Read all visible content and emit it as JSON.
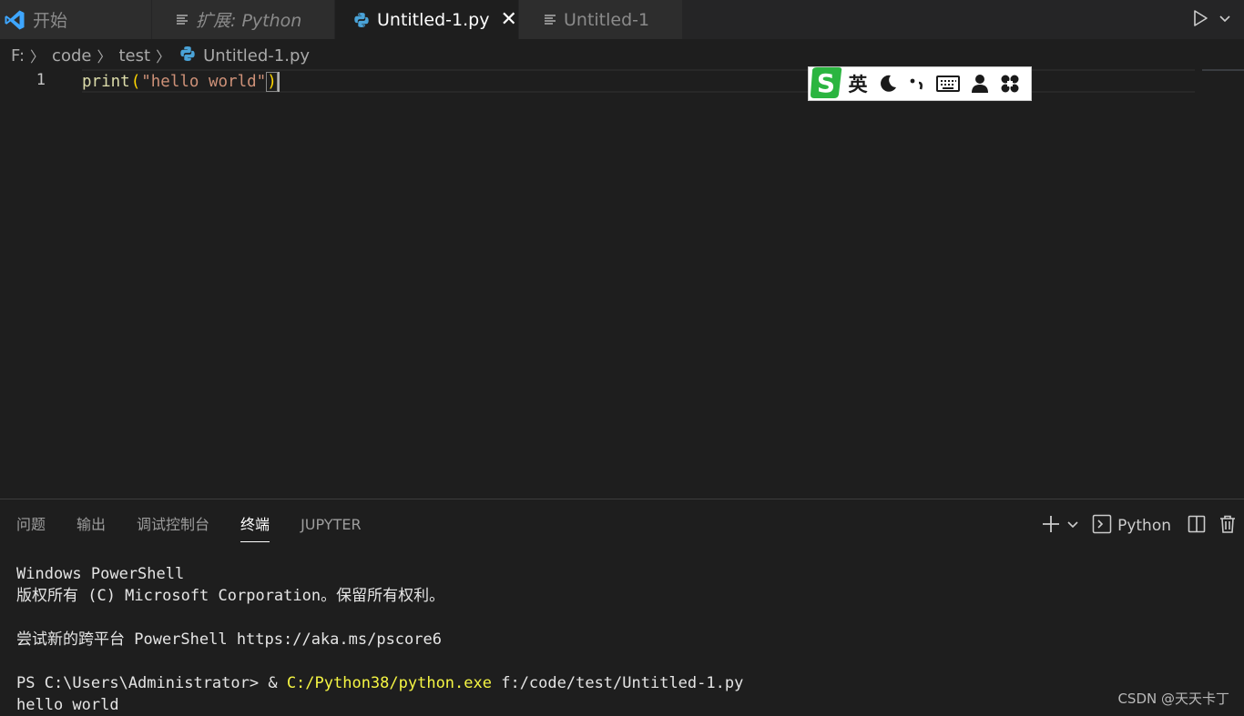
{
  "tabs": [
    {
      "label": "开始",
      "icon": "vscode-logo-icon"
    },
    {
      "label": "扩展: Python",
      "icon": "preview-lines-icon"
    },
    {
      "label": "Untitled-1.py",
      "icon": "python-icon",
      "active": true
    },
    {
      "label": "Untitled-1",
      "icon": "text-file-icon"
    }
  ],
  "breadcrumb": {
    "drive": "F:",
    "folder1": "code",
    "folder2": "test",
    "file": "Untitled-1.py"
  },
  "editor": {
    "line_number": "1",
    "code": {
      "fn": "print",
      "open_paren": "(",
      "string": "\"hello world\"",
      "close_paren": ")"
    }
  },
  "ime_toolbar": {
    "logo": "S",
    "language": "英",
    "icons": [
      "moon-icon",
      "punctuation-icon",
      "keyboard-icon",
      "user-icon",
      "apps-icon"
    ]
  },
  "panel": {
    "tabs": [
      "问题",
      "输出",
      "调试控制台",
      "终端",
      "JUPYTER"
    ],
    "active_tab": "终端",
    "terminal_profile": "Python",
    "terminal": {
      "line1": "Windows PowerShell",
      "line2": "版权所有 (C) Microsoft Corporation。保留所有权利。",
      "line3": "尝试新的跨平台 PowerShell https://aka.ms/pscore6",
      "prompt": "PS C:\\Users\\Administrator> & ",
      "exe": "C:/Python38/python.exe",
      "args": " f:/code/test/Untitled-1.py",
      "output": "hello world"
    }
  },
  "watermark": "CSDN @天天卡丁",
  "colors": {
    "editor_bg": "#1e1e1e",
    "tabbar_bg": "#252526",
    "function": "#dcdcaa",
    "string": "#ce9178",
    "bracket": "#ffd700",
    "exe_highlight": "#f5f543",
    "vscode_blue": "#3ea6ff"
  }
}
